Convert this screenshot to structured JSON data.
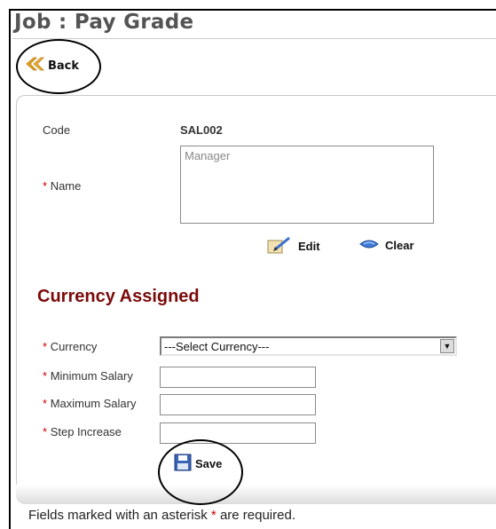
{
  "page": {
    "title": "Job : Pay Grade",
    "back_label": "Back"
  },
  "form": {
    "code_label": "Code",
    "code_value": "SAL002",
    "name_label": "Name",
    "name_value": "Manager",
    "edit_label": "Edit",
    "clear_label": "Clear"
  },
  "currency": {
    "section_title": "Currency Assigned",
    "currency_label": "Currency",
    "currency_selected": "---Select Currency---",
    "min_salary_label": "Minimum Salary",
    "max_salary_label": "Maximum Salary",
    "step_label": "Step Increase",
    "save_label": "Save"
  },
  "footer": {
    "text_before": "Fields marked with an asterisk",
    "asterisk": "*",
    "text_after": "are required."
  },
  "colors": {
    "accent_orange": "#e8a11c",
    "section_title": "#7a0b0b",
    "required_star": "#cc0000"
  }
}
